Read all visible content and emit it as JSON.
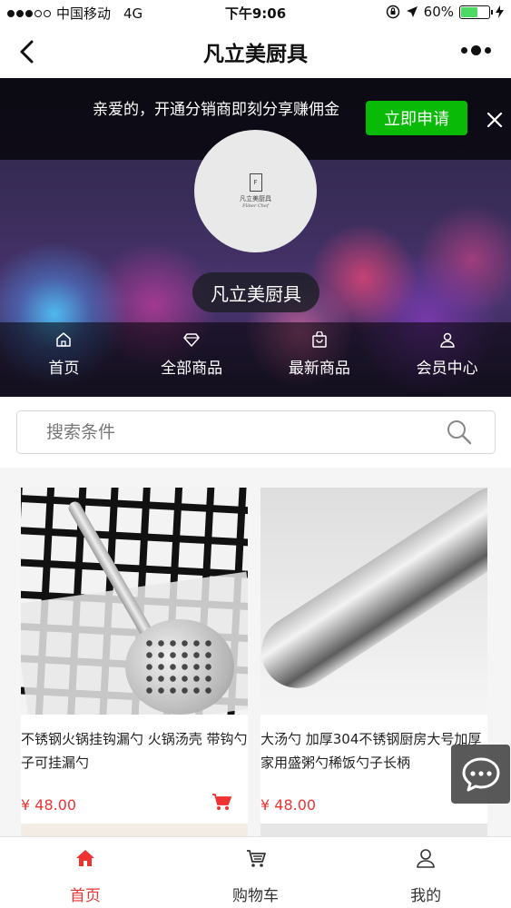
{
  "status_bar": {
    "carrier": "中国移动",
    "network": "4G",
    "time": "下午9:06",
    "battery": "60%",
    "battery_level": 0.6
  },
  "nav": {
    "title": "凡立美厨具"
  },
  "promo": {
    "text": "亲爱的，开通分销商即刻分享赚佣金",
    "button": "立即申请"
  },
  "shop": {
    "logo_text": "凡立美厨具",
    "logo_sub": "Fliber Chef",
    "name": "凡立美厨具",
    "nav": [
      {
        "label": "首页",
        "icon": "home-icon"
      },
      {
        "label": "全部商品",
        "icon": "diamond-icon"
      },
      {
        "label": "最新商品",
        "icon": "bag-icon"
      },
      {
        "label": "会员中心",
        "icon": "user-icon"
      }
    ]
  },
  "search": {
    "placeholder": "搜索条件"
  },
  "products": [
    {
      "title": "不锈钢火锅挂钩漏勺 火锅汤壳 带钩勺子可挂漏勺",
      "price": "¥ 48.00"
    },
    {
      "title": "大汤勺 加厚304不锈钢厨房大号加厚家用盛粥勺稀饭勺子长柄",
      "price": "¥ 48.00"
    }
  ],
  "tab_bar": [
    {
      "label": "首页",
      "icon": "home-icon",
      "active": true
    },
    {
      "label": "购物车",
      "icon": "cart-icon",
      "active": false
    },
    {
      "label": "我的",
      "icon": "user-icon",
      "active": false
    }
  ],
  "colors": {
    "accent": "#e33333",
    "promo_button": "#09bb07"
  }
}
